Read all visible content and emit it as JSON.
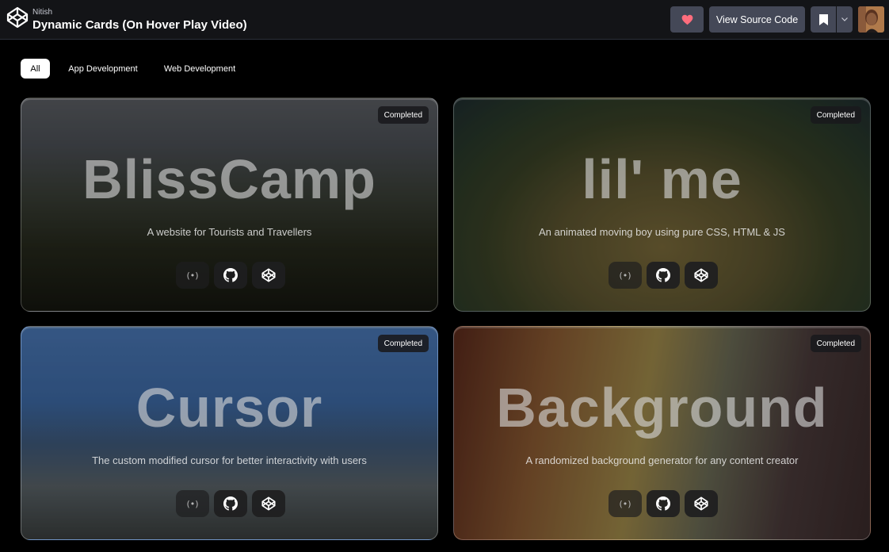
{
  "header": {
    "author": "Nitish",
    "title": "Dynamic Cards (On Hover Play Video)",
    "view_source_label": "View Source Code",
    "icons": {
      "logo": "codepen-logo-icon",
      "heart": "heart-icon",
      "bookmark": "bookmark-icon",
      "caret": "chevron-down-icon"
    },
    "heart_color": "#ff6d7d"
  },
  "filters": [
    {
      "label": "All",
      "active": true
    },
    {
      "label": "App Development",
      "active": false
    },
    {
      "label": "Web Development",
      "active": false
    }
  ],
  "cards": [
    {
      "title": "BlissCamp",
      "description": "A website for Tourists and Travellers",
      "status": "Completed",
      "actions": [
        "live-icon",
        "github-icon",
        "codepen-icon"
      ]
    },
    {
      "title": "lil' me",
      "description": "An animated moving boy using pure CSS, HTML & JS",
      "status": "Completed",
      "actions": [
        "live-icon",
        "github-icon",
        "codepen-icon"
      ]
    },
    {
      "title": "Cursor",
      "description": "The custom modified cursor for better interactivity with users",
      "status": "Completed",
      "actions": [
        "live-icon",
        "github-icon",
        "codepen-icon"
      ]
    },
    {
      "title": "Background",
      "description": "A randomized background generator for any content creator",
      "status": "Completed",
      "actions": [
        "live-icon",
        "github-icon",
        "codepen-icon"
      ]
    }
  ],
  "live_glyph": "(•)"
}
